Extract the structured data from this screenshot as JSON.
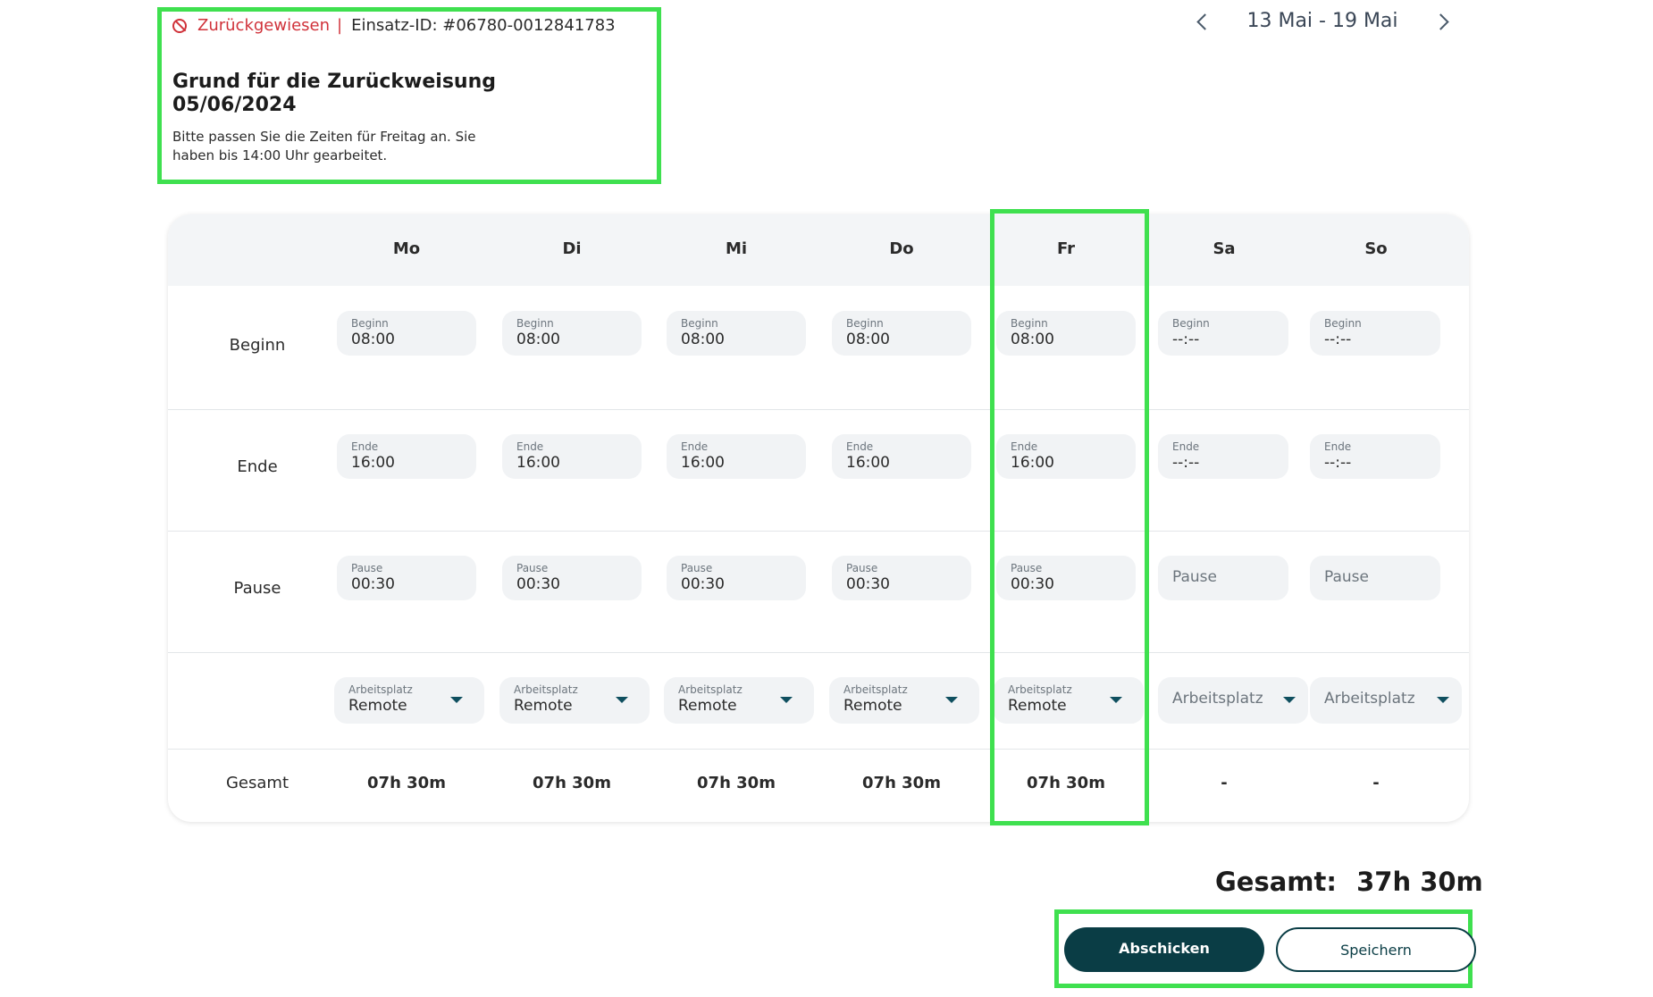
{
  "status": {
    "label": "Zurückgewiesen",
    "separator": "|",
    "einsatz_id": "Einsatz-ID: #06780-0012841783"
  },
  "rejection": {
    "title": "Grund für die Zurückweisung 05/06/2024",
    "text": "Bitte passen Sie die Zeiten für Freitag an. Sie haben bis 14:00 Uhr gearbeitet."
  },
  "week": {
    "label": "13 Mai - 19 Mai"
  },
  "rows": {
    "begin": "Beginn",
    "end": "Ende",
    "pause": "Pause",
    "total": "Gesamt"
  },
  "days": [
    {
      "name": "Mo",
      "begin_label": "Beginn",
      "begin": "08:00",
      "end_label": "Ende",
      "end": "16:00",
      "pause_label": "Pause",
      "pause": "00:30",
      "workplace_label": "Arbeitsplatz",
      "workplace": "Remote",
      "total": "07h 30m"
    },
    {
      "name": "Di",
      "begin_label": "Beginn",
      "begin": "08:00",
      "end_label": "Ende",
      "end": "16:00",
      "pause_label": "Pause",
      "pause": "00:30",
      "workplace_label": "Arbeitsplatz",
      "workplace": "Remote",
      "total": "07h 30m"
    },
    {
      "name": "Mi",
      "begin_label": "Beginn",
      "begin": "08:00",
      "end_label": "Ende",
      "end": "16:00",
      "pause_label": "Pause",
      "pause": "00:30",
      "workplace_label": "Arbeitsplatz",
      "workplace": "Remote",
      "total": "07h 30m"
    },
    {
      "name": "Do",
      "begin_label": "Beginn",
      "begin": "08:00",
      "end_label": "Ende",
      "end": "16:00",
      "pause_label": "Pause",
      "pause": "00:30",
      "workplace_label": "Arbeitsplatz",
      "workplace": "Remote",
      "total": "07h 30m"
    },
    {
      "name": "Fr",
      "begin_label": "Beginn",
      "begin": "08:00",
      "end_label": "Ende",
      "end": "16:00",
      "pause_label": "Pause",
      "pause": "00:30",
      "workplace_label": "Arbeitsplatz",
      "workplace": "Remote",
      "total": "07h 30m"
    },
    {
      "name": "Sa",
      "begin_label": "Beginn",
      "begin": "--:--",
      "end_label": "Ende",
      "end": "--:--",
      "pause_placeholder": "Pause",
      "workplace_placeholder": "Arbeitsplatz",
      "total": "-"
    },
    {
      "name": "So",
      "begin_label": "Beginn",
      "begin": "--:--",
      "end_label": "Ende",
      "end": "--:--",
      "pause_placeholder": "Pause",
      "workplace_placeholder": "Arbeitsplatz",
      "total": "-"
    }
  ],
  "summary": {
    "label": "Gesamt:",
    "value": "37h 30m"
  },
  "actions": {
    "submit": "Abschicken",
    "save": "Speichern"
  },
  "colors": {
    "highlight": "#3fe04f",
    "status_red": "#d0323a",
    "primary": "#0a3d45"
  }
}
